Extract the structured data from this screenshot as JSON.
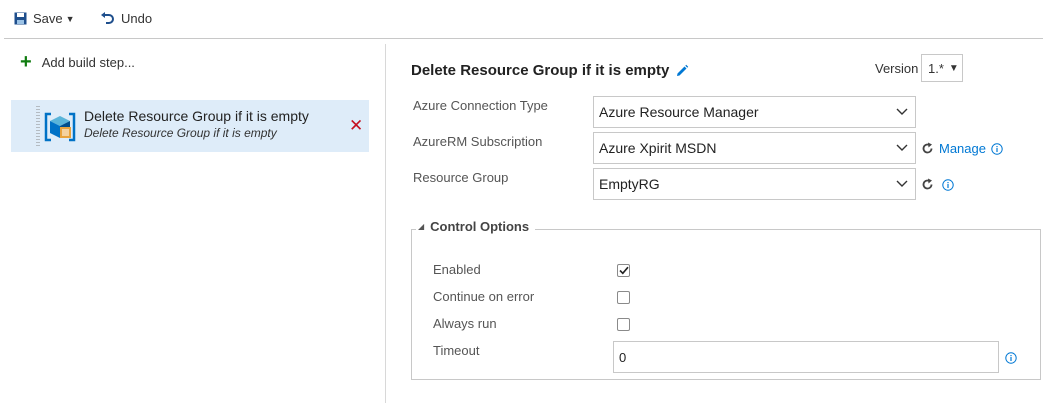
{
  "toolbar": {
    "save_label": "Save",
    "undo_label": "Undo"
  },
  "left_pane": {
    "add_step_label": "Add build step...",
    "task": {
      "name": "Delete Resource Group if it is empty",
      "description": "Delete Resource Group if it is empty"
    }
  },
  "task_editor": {
    "title": "Delete Resource Group if it is empty",
    "version_label": "Version",
    "version_value": "1.*",
    "fields": {
      "connection_type": {
        "label": "Azure Connection Type",
        "value": "Azure Resource Manager"
      },
      "subscription": {
        "label": "AzureRM Subscription",
        "value": "Azure Xpirit MSDN",
        "manage_label": "Manage"
      },
      "resource_group": {
        "label": "Resource Group",
        "value": "EmptyRG"
      }
    },
    "control_options": {
      "title": "Control Options",
      "enabled": {
        "label": "Enabled",
        "checked": true
      },
      "continue_on_error": {
        "label": "Continue on error",
        "checked": false
      },
      "always_run": {
        "label": "Always run",
        "checked": false
      },
      "timeout": {
        "label": "Timeout",
        "value": "0"
      }
    }
  },
  "colors": {
    "accent": "#0078d4",
    "selected_bg": "#deecf9",
    "remove": "#c50f1f",
    "add": "#107c10"
  },
  "icons": [
    "save-icon",
    "undo-icon",
    "plus-icon",
    "azure-task-icon",
    "remove-icon",
    "pencil-icon",
    "chevron-down-icon",
    "refresh-icon",
    "info-icon",
    "collapse-triangle-icon",
    "checkmark-icon"
  ]
}
